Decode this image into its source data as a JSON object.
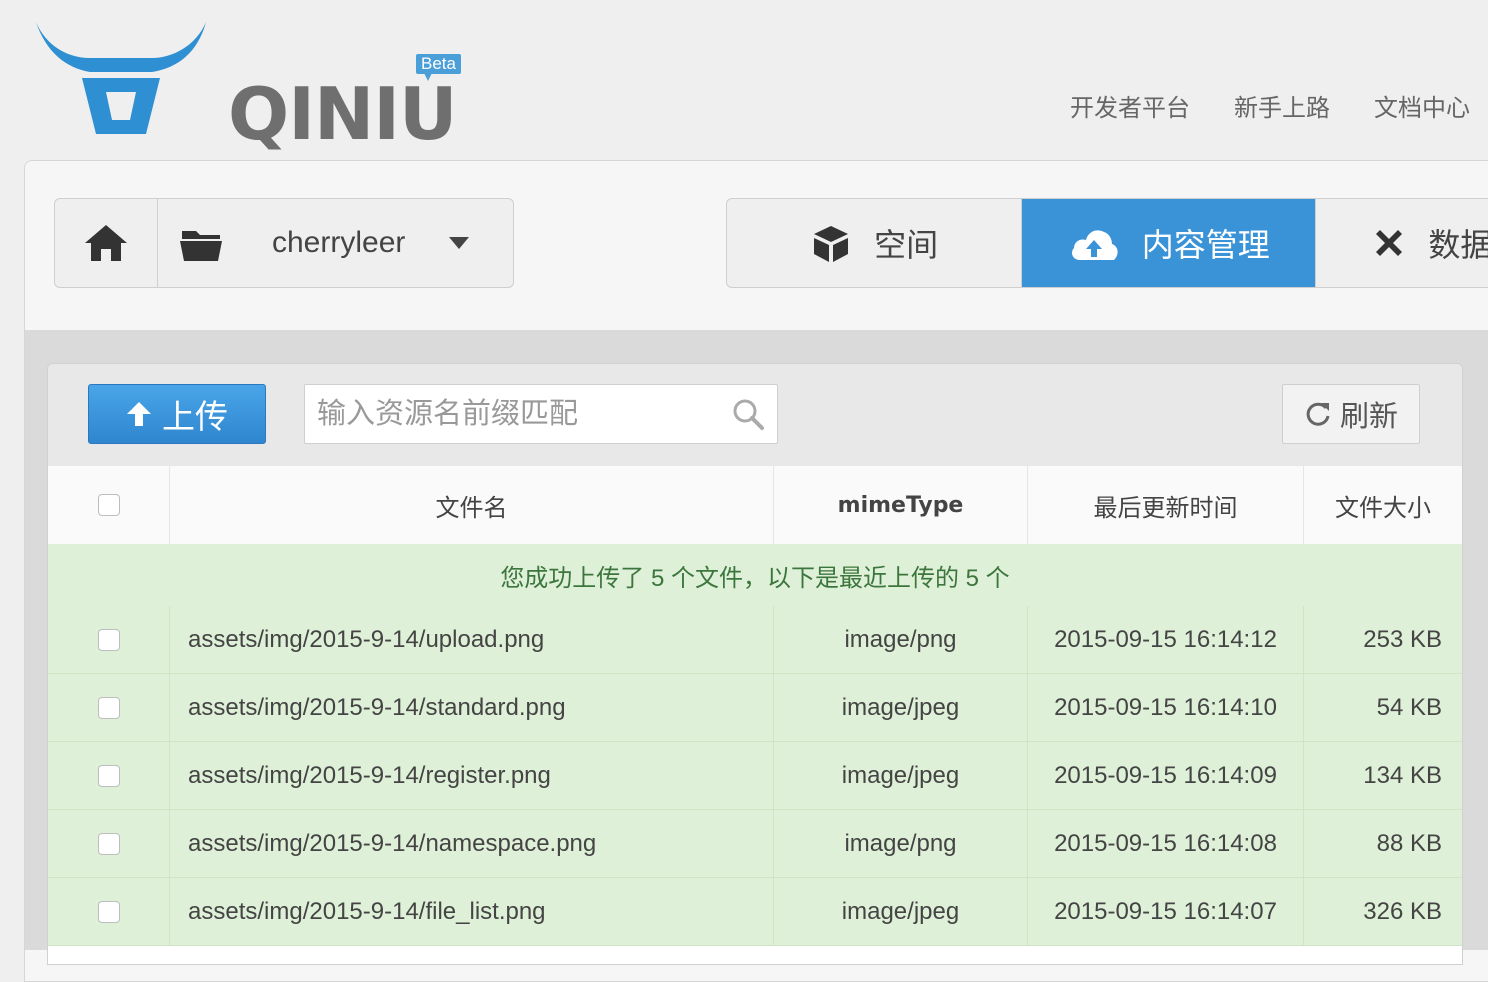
{
  "brand": {
    "name": "QINIU",
    "badge": "Beta"
  },
  "topnav": [
    "开发者平台",
    "新手上路",
    "文档中心"
  ],
  "space_selector": {
    "bucket": "cherryleer"
  },
  "tabs": [
    {
      "label": "空间",
      "icon": "box-icon"
    },
    {
      "label": "内容管理",
      "icon": "cloud-upload-icon",
      "active": true
    },
    {
      "label": "数据",
      "icon": "tools-icon"
    }
  ],
  "toolbar": {
    "upload_label": "上传",
    "search_placeholder": "输入资源名前缀匹配",
    "refresh_label": "刷新"
  },
  "table": {
    "columns": [
      "文件名",
      "mimeType",
      "最后更新时间",
      "文件大小"
    ],
    "notice": "您成功上传了 5 个文件，以下是最近上传的 5 个",
    "rows": [
      {
        "name": "assets/img/2015-9-14/upload.png",
        "mime": "image/png",
        "time": "2015-09-15 16:14:12",
        "size": "253 KB"
      },
      {
        "name": "assets/img/2015-9-14/standard.png",
        "mime": "image/jpeg",
        "time": "2015-09-15 16:14:10",
        "size": "54 KB"
      },
      {
        "name": "assets/img/2015-9-14/register.png",
        "mime": "image/jpeg",
        "time": "2015-09-15 16:14:09",
        "size": "134 KB"
      },
      {
        "name": "assets/img/2015-9-14/namespace.png",
        "mime": "image/png",
        "time": "2015-09-15 16:14:08",
        "size": "88 KB"
      },
      {
        "name": "assets/img/2015-9-14/file_list.png",
        "mime": "image/jpeg",
        "time": "2015-09-15 16:14:07",
        "size": "326 KB"
      }
    ]
  },
  "colors": {
    "accent": "#3a93d6",
    "success_bg": "#dff0d8",
    "success_text": "#3c763d"
  }
}
